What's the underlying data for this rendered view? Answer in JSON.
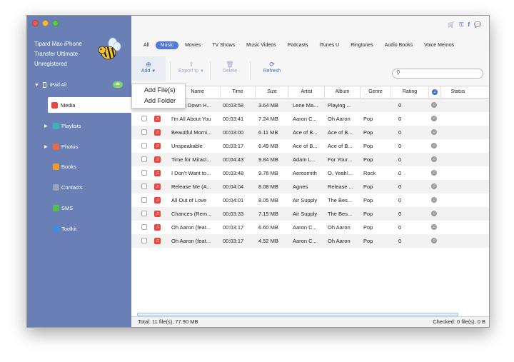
{
  "app": {
    "name_lines": [
      "Tipard Mac iPhone",
      "Transfer Ultimate",
      "Unregistered"
    ]
  },
  "device": {
    "label": "iPad Air"
  },
  "sidebar": {
    "items": [
      {
        "label": "Media",
        "icon": "media-icon",
        "color": "#e8473f",
        "active": true,
        "expand": ""
      },
      {
        "label": "Playlists",
        "icon": "playlists-icon",
        "color": "#3fb3b0",
        "active": false,
        "expand": "▶"
      },
      {
        "label": "Photos",
        "icon": "photos-icon",
        "color": "#e96b46",
        "active": false,
        "expand": "▶"
      },
      {
        "label": "Books",
        "icon": "books-icon",
        "color": "#f39b2a",
        "active": false,
        "expand": ""
      },
      {
        "label": "Contacts",
        "icon": "contacts-icon",
        "color": "#9aa3b5",
        "active": false,
        "expand": ""
      },
      {
        "label": "SMS",
        "icon": "sms-icon",
        "color": "#4cc251",
        "active": false,
        "expand": ""
      },
      {
        "label": "Toolkit",
        "icon": "toolkit-icon",
        "color": "#3d8fe0",
        "active": false,
        "expand": ""
      }
    ]
  },
  "tabs": [
    "All",
    "Music",
    "Movies",
    "TV Shows",
    "Music Videos",
    "Podcasts",
    "iTunes U",
    "Ringtones",
    "Audio Books",
    "Voice Memos"
  ],
  "active_tab": "Music",
  "toolbar": {
    "add": "Add",
    "export": "Export to",
    "delete": "Delete",
    "refresh": "Refresh"
  },
  "dropdown": {
    "items": [
      "Add File(s)",
      "Add Folder"
    ]
  },
  "table": {
    "headers": [
      "Name",
      "Time",
      "Size",
      "Artist",
      "Album",
      "Genre",
      "Rating",
      "Status"
    ],
    "rows": [
      [
        "Sitting Down H...",
        "00:03:58",
        "3.64 MB",
        "Lene Ma...",
        "Playing ...",
        "",
        "0"
      ],
      [
        "I'm All About You",
        "00:03:41",
        "7.24 MB",
        "Aaron C...",
        "Oh Aaron",
        "Pop",
        "0"
      ],
      [
        "Beautiful Morni...",
        "00:03:00",
        "6.11 MB",
        "Ace of B...",
        "Ace of B...",
        "Pop",
        "0"
      ],
      [
        "Unspeakable",
        "00:03:17",
        "6.49 MB",
        "Ace of B...",
        "Ace of B...",
        "Pop",
        "0"
      ],
      [
        "Time for Miracl...",
        "00:04:43",
        "9.84 MB",
        "Adam L...",
        "For Your...",
        "Pop",
        "0"
      ],
      [
        "I Don't Want to...",
        "00:03:48",
        "9.76 MB",
        "Aerosmith",
        "O, Yeah!...",
        "Rock",
        "0"
      ],
      [
        "Release Me (A...",
        "00:04:04",
        "8.08 MB",
        "Agnes",
        "Release ...",
        "Pop",
        "0"
      ],
      [
        "All Out of Love",
        "00:04:01",
        "8.05 MB",
        "Air Supply",
        "The Bes...",
        "Pop",
        "0"
      ],
      [
        "Chances (Rem...",
        "00:03:33",
        "7.15 MB",
        "Air Supply",
        "The Bes...",
        "Pop",
        "0"
      ],
      [
        "Oh Aaron (feat...",
        "00:03:17",
        "6.60 MB",
        "Aaron C...",
        "Oh Aaron",
        "Pop",
        "0"
      ],
      [
        "Oh Aaron (feat...",
        "00:03:17",
        "4.52 MB",
        "Aaron C...",
        "Oh Aaron",
        "Pop",
        "0"
      ]
    ]
  },
  "status": {
    "total": "Total: 11 file(s), 77.90 MB",
    "checked": "Checked: 0 file(s), 0 B"
  },
  "colors": {
    "sidebar": "#6a7fb5",
    "accent": "#4f78d9"
  }
}
